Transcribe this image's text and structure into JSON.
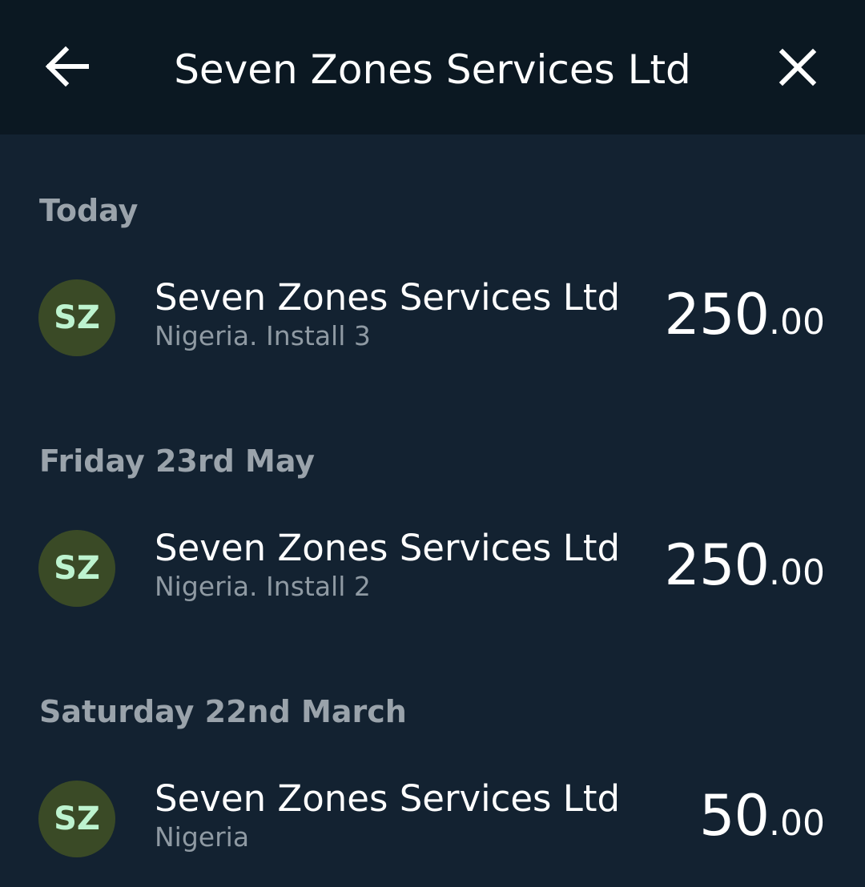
{
  "header": {
    "title": "Seven Zones Services Ltd",
    "back_icon": "arrow-left-icon",
    "close_icon": "close-icon"
  },
  "sections": [
    {
      "label": "Today",
      "transactions": [
        {
          "avatar_initials": "SZ",
          "title": "Seven Zones Services Ltd",
          "subtitle": "Nigeria. Install 3",
          "amount_int": "250",
          "amount_dec": ".00"
        }
      ]
    },
    {
      "label": "Friday 23rd May",
      "transactions": [
        {
          "avatar_initials": "SZ",
          "title": "Seven Zones Services Ltd",
          "subtitle": "Nigeria. Install 2",
          "amount_int": "250",
          "amount_dec": ".00"
        }
      ]
    },
    {
      "label": "Saturday 22nd March",
      "transactions": [
        {
          "avatar_initials": "SZ",
          "title": "Seven Zones Services Ltd",
          "subtitle": "Nigeria",
          "amount_int": "50",
          "amount_dec": ".00"
        }
      ]
    }
  ],
  "colors": {
    "background": "#132231",
    "header_background": "#0b1822",
    "avatar_background": "#3a4a26",
    "avatar_text": "#bdf3cf",
    "section_label": "#9aa3ab",
    "subtitle": "#8f9aa3"
  }
}
